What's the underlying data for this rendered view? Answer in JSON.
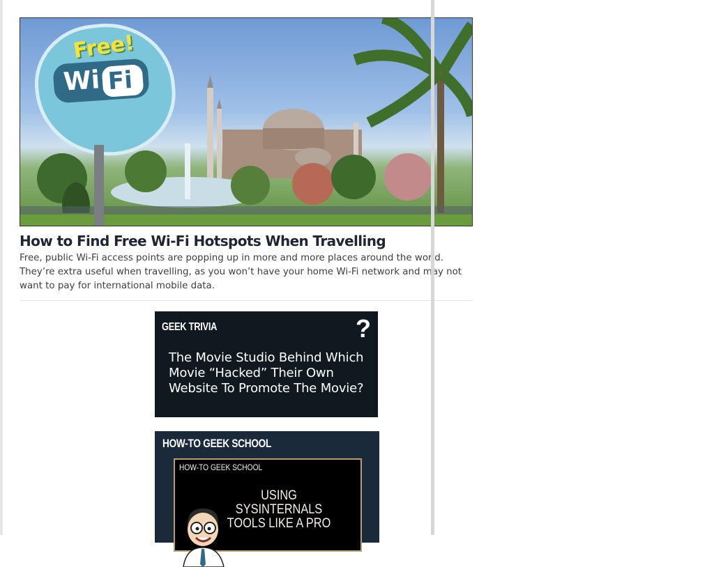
{
  "article": {
    "image_alt": "Free Wi-Fi sign in front of Hagia Sophia",
    "sign_free": "Free!",
    "sign_wi": "Wi",
    "sign_fi": "Fi",
    "title": "How to Find Free Wi-Fi Hotspots When Travelling",
    "excerpt": "Free, public Wi-Fi access points are popping up in more and more places around the world. They’re extra useful when travelling, as you won’t have your home Wi-Fi network and may not want to pay for international mobile data."
  },
  "trivia": {
    "heading": "GEEK TRIVIA",
    "icon": "question-mark-icon",
    "question_mark": "?",
    "question": "The Movie Studio Behind Which Movie “Hacked” Their Own Website To Promote The Movie?"
  },
  "school": {
    "heading": "HOW-TO GEEK SCHOOL",
    "board_label": "HOW-TO GEEK SCHOOL",
    "board_title": "USING SYSINTERNALS TOOLS LIKE A PRO"
  },
  "colors": {
    "widget_bg": "#101820",
    "title_text": "#1e2633",
    "board_border": "#b8a06a"
  }
}
